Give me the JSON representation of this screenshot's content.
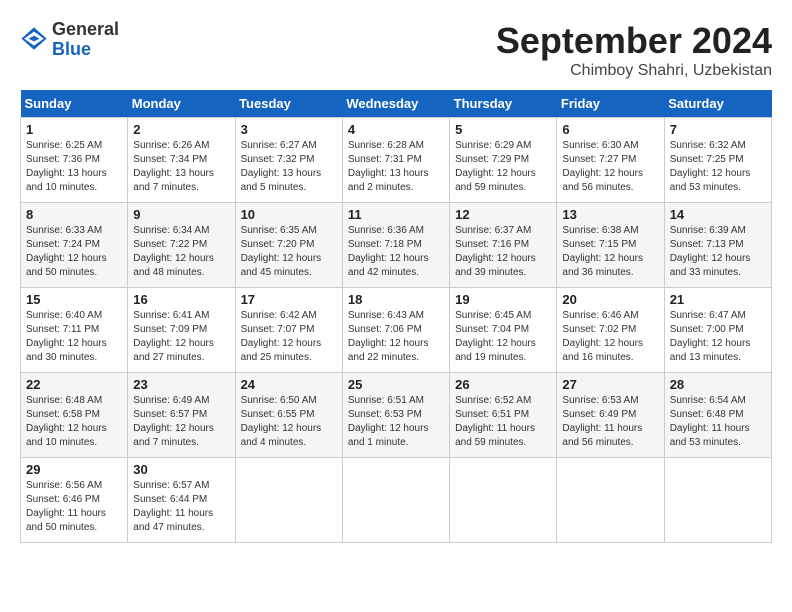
{
  "header": {
    "logo_general": "General",
    "logo_blue": "Blue",
    "month_title": "September 2024",
    "location": "Chimboy Shahri, Uzbekistan"
  },
  "columns": [
    "Sunday",
    "Monday",
    "Tuesday",
    "Wednesday",
    "Thursday",
    "Friday",
    "Saturday"
  ],
  "weeks": [
    [
      {
        "day": "1",
        "sunrise": "6:25 AM",
        "sunset": "7:36 PM",
        "daylight": "13 hours and 10 minutes."
      },
      {
        "day": "2",
        "sunrise": "6:26 AM",
        "sunset": "7:34 PM",
        "daylight": "13 hours and 7 minutes."
      },
      {
        "day": "3",
        "sunrise": "6:27 AM",
        "sunset": "7:32 PM",
        "daylight": "13 hours and 5 minutes."
      },
      {
        "day": "4",
        "sunrise": "6:28 AM",
        "sunset": "7:31 PM",
        "daylight": "13 hours and 2 minutes."
      },
      {
        "day": "5",
        "sunrise": "6:29 AM",
        "sunset": "7:29 PM",
        "daylight": "12 hours and 59 minutes."
      },
      {
        "day": "6",
        "sunrise": "6:30 AM",
        "sunset": "7:27 PM",
        "daylight": "12 hours and 56 minutes."
      },
      {
        "day": "7",
        "sunrise": "6:32 AM",
        "sunset": "7:25 PM",
        "daylight": "12 hours and 53 minutes."
      }
    ],
    [
      {
        "day": "8",
        "sunrise": "6:33 AM",
        "sunset": "7:24 PM",
        "daylight": "12 hours and 50 minutes."
      },
      {
        "day": "9",
        "sunrise": "6:34 AM",
        "sunset": "7:22 PM",
        "daylight": "12 hours and 48 minutes."
      },
      {
        "day": "10",
        "sunrise": "6:35 AM",
        "sunset": "7:20 PM",
        "daylight": "12 hours and 45 minutes."
      },
      {
        "day": "11",
        "sunrise": "6:36 AM",
        "sunset": "7:18 PM",
        "daylight": "12 hours and 42 minutes."
      },
      {
        "day": "12",
        "sunrise": "6:37 AM",
        "sunset": "7:16 PM",
        "daylight": "12 hours and 39 minutes."
      },
      {
        "day": "13",
        "sunrise": "6:38 AM",
        "sunset": "7:15 PM",
        "daylight": "12 hours and 36 minutes."
      },
      {
        "day": "14",
        "sunrise": "6:39 AM",
        "sunset": "7:13 PM",
        "daylight": "12 hours and 33 minutes."
      }
    ],
    [
      {
        "day": "15",
        "sunrise": "6:40 AM",
        "sunset": "7:11 PM",
        "daylight": "12 hours and 30 minutes."
      },
      {
        "day": "16",
        "sunrise": "6:41 AM",
        "sunset": "7:09 PM",
        "daylight": "12 hours and 27 minutes."
      },
      {
        "day": "17",
        "sunrise": "6:42 AM",
        "sunset": "7:07 PM",
        "daylight": "12 hours and 25 minutes."
      },
      {
        "day": "18",
        "sunrise": "6:43 AM",
        "sunset": "7:06 PM",
        "daylight": "12 hours and 22 minutes."
      },
      {
        "day": "19",
        "sunrise": "6:45 AM",
        "sunset": "7:04 PM",
        "daylight": "12 hours and 19 minutes."
      },
      {
        "day": "20",
        "sunrise": "6:46 AM",
        "sunset": "7:02 PM",
        "daylight": "12 hours and 16 minutes."
      },
      {
        "day": "21",
        "sunrise": "6:47 AM",
        "sunset": "7:00 PM",
        "daylight": "12 hours and 13 minutes."
      }
    ],
    [
      {
        "day": "22",
        "sunrise": "6:48 AM",
        "sunset": "6:58 PM",
        "daylight": "12 hours and 10 minutes."
      },
      {
        "day": "23",
        "sunrise": "6:49 AM",
        "sunset": "6:57 PM",
        "daylight": "12 hours and 7 minutes."
      },
      {
        "day": "24",
        "sunrise": "6:50 AM",
        "sunset": "6:55 PM",
        "daylight": "12 hours and 4 minutes."
      },
      {
        "day": "25",
        "sunrise": "6:51 AM",
        "sunset": "6:53 PM",
        "daylight": "12 hours and 1 minute."
      },
      {
        "day": "26",
        "sunrise": "6:52 AM",
        "sunset": "6:51 PM",
        "daylight": "11 hours and 59 minutes."
      },
      {
        "day": "27",
        "sunrise": "6:53 AM",
        "sunset": "6:49 PM",
        "daylight": "11 hours and 56 minutes."
      },
      {
        "day": "28",
        "sunrise": "6:54 AM",
        "sunset": "6:48 PM",
        "daylight": "11 hours and 53 minutes."
      }
    ],
    [
      {
        "day": "29",
        "sunrise": "6:56 AM",
        "sunset": "6:46 PM",
        "daylight": "11 hours and 50 minutes."
      },
      {
        "day": "30",
        "sunrise": "6:57 AM",
        "sunset": "6:44 PM",
        "daylight": "11 hours and 47 minutes."
      },
      null,
      null,
      null,
      null,
      null
    ]
  ]
}
